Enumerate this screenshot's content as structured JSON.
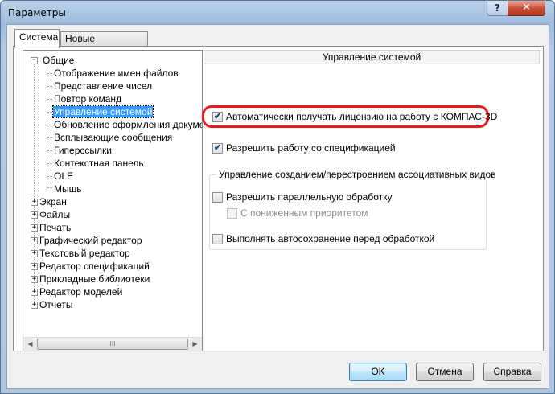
{
  "window": {
    "title": "Параметры",
    "help_glyph": "?",
    "close_glyph": "✕"
  },
  "tabs": [
    {
      "label": "Система",
      "active": true
    },
    {
      "label": "Новые документы",
      "active": false
    }
  ],
  "tree": {
    "items": [
      {
        "label": "Общие",
        "expander": "−"
      },
      {
        "label": "Отображение имен файлов"
      },
      {
        "label": "Представление чисел"
      },
      {
        "label": "Повтор команд"
      },
      {
        "label": "Управление системой",
        "selected": true
      },
      {
        "label": "Обновление оформления документ"
      },
      {
        "label": "Всплывающие сообщения"
      },
      {
        "label": "Гиперссылки"
      },
      {
        "label": "Контекстная панель"
      },
      {
        "label": "OLE"
      },
      {
        "label": "Мышь"
      },
      {
        "label": "Экран",
        "expander": "+"
      },
      {
        "label": "Файлы",
        "expander": "+"
      },
      {
        "label": "Печать",
        "expander": "+"
      },
      {
        "label": "Графический редактор",
        "expander": "+"
      },
      {
        "label": "Текстовый редактор",
        "expander": "+"
      },
      {
        "label": "Редактор спецификаций",
        "expander": "+"
      },
      {
        "label": "Прикладные библиотеки",
        "expander": "+"
      },
      {
        "label": "Редактор моделей",
        "expander": "+"
      },
      {
        "label": "Отчеты",
        "expander": "+"
      }
    ],
    "scroll_left": "◀",
    "scroll_right": "▶",
    "scroll_grip": "III"
  },
  "panel": {
    "header": "Управление системой",
    "check_license": {
      "label": "Автоматически получать лицензию на работу с КОМПАС-3D",
      "checked": true,
      "mark": "✔"
    },
    "check_specs": {
      "label": "Разрешить работу со спецификацией",
      "checked": true,
      "mark": "✔"
    },
    "group": {
      "title": "Управление созданием/перестроением ассоциативных видов",
      "parallel": {
        "label": "Разрешить параллельную обработку",
        "checked": false
      },
      "low_priority": {
        "label": "С пониженным приоритетом",
        "checked": false,
        "disabled": true
      },
      "autosave": {
        "label": "Выполнять автосохранение перед обработкой",
        "checked": false
      }
    }
  },
  "buttons": {
    "ok": "OK",
    "cancel": "Отмена",
    "help": "Справка"
  },
  "colors": {
    "highlight_ring": "#e41d1d",
    "selection": "#3399ff"
  }
}
